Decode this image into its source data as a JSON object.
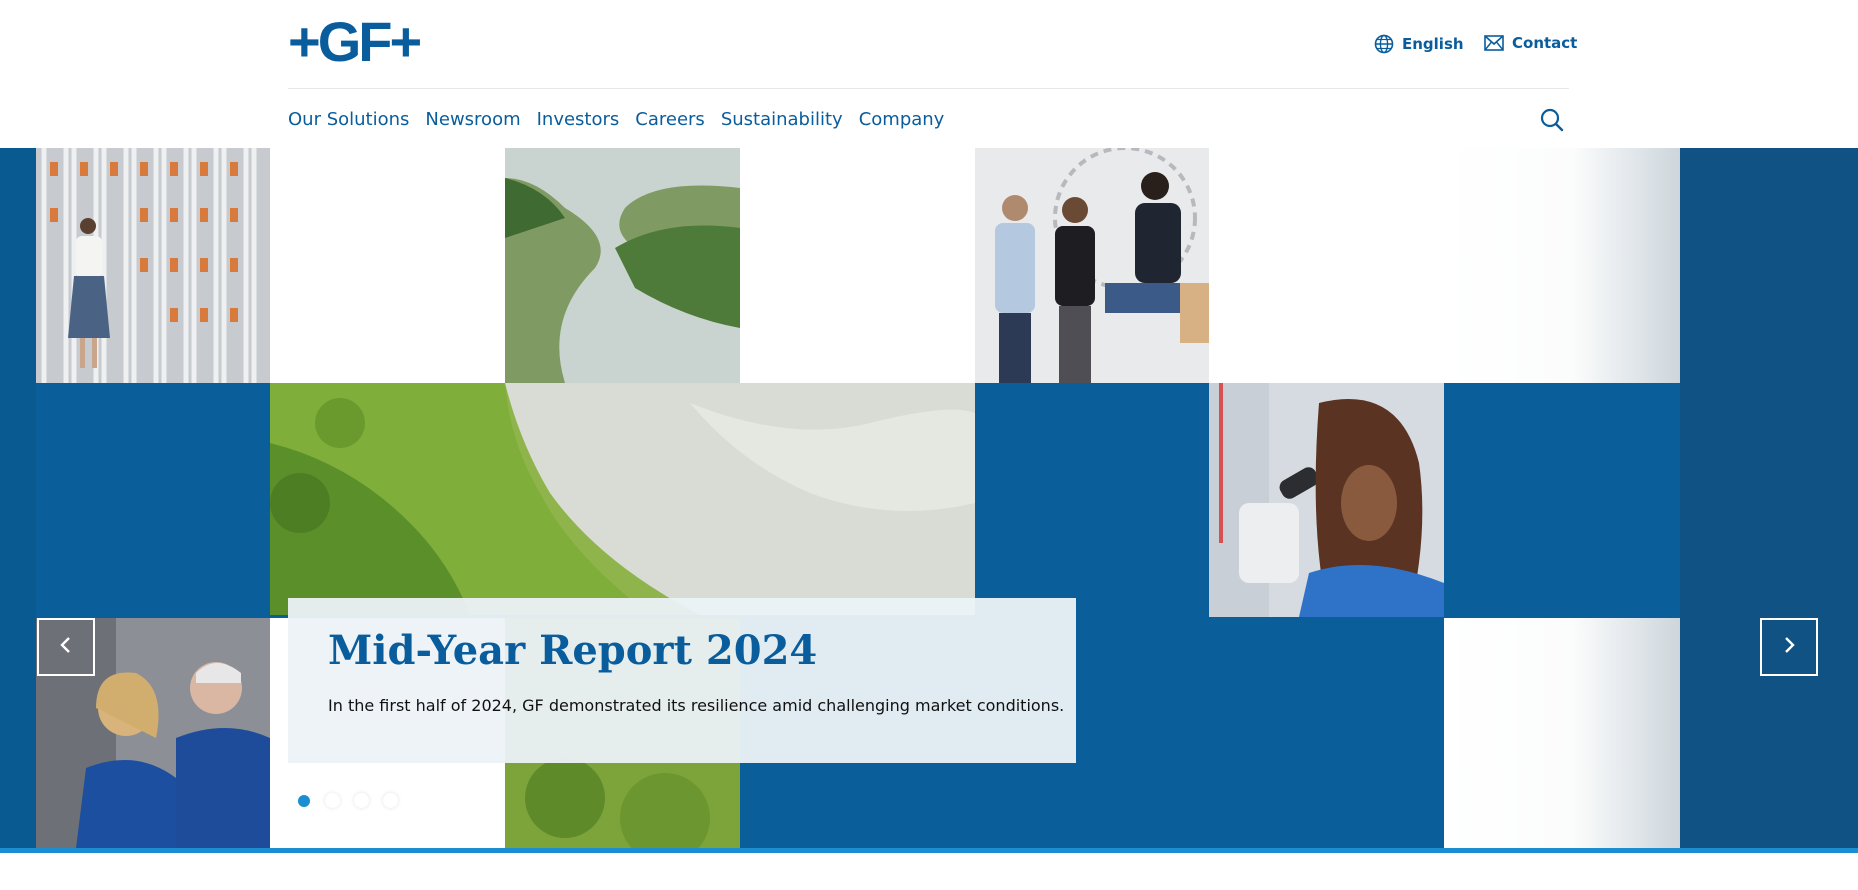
{
  "brand": {
    "logo_text": "+GF+",
    "color": "#0a5d9c"
  },
  "utility": {
    "language": "English",
    "contact": "Contact"
  },
  "nav": {
    "items": [
      "Our Solutions",
      "Newsroom",
      "Investors",
      "Careers",
      "Sustainability",
      "Company"
    ]
  },
  "hero": {
    "title": "Mid-Year Report 2024",
    "text": "In the first half of 2024, GF demonstrated its resilience amid challenging market conditions.",
    "slides": 4,
    "active_slide": 1
  },
  "colors": {
    "hero_blue": "#0a5e99",
    "accent": "#1a8ed0"
  }
}
